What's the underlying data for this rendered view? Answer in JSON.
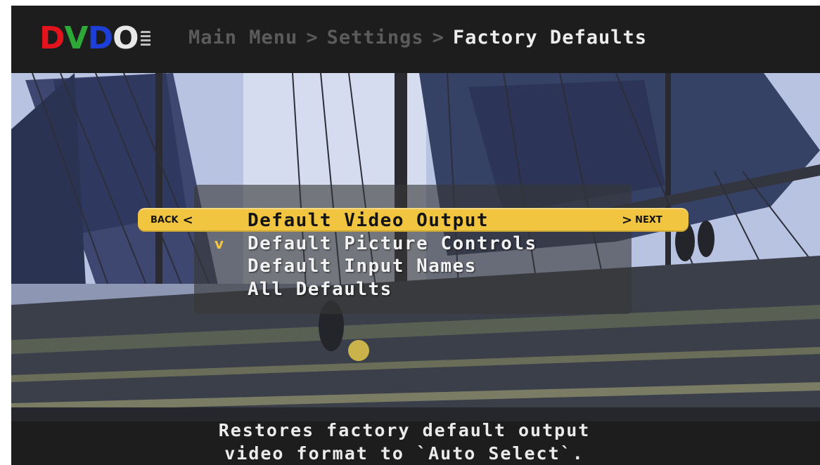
{
  "header": {
    "logo": {
      "letters": [
        "D",
        "V",
        "D",
        "O"
      ],
      "colors": [
        "#e4141c",
        "#2ea836",
        "#1e3fd6",
        "#e8e8e8"
      ]
    },
    "breadcrumb": {
      "items": [
        "Main Menu",
        "Settings",
        "Factory Defaults"
      ],
      "separator": ">"
    }
  },
  "menu": {
    "back_label": "BACK",
    "next_label": "NEXT",
    "back_arrow": "<",
    "next_arrow": ">",
    "items": [
      {
        "label": "Default Video Output",
        "selected": true,
        "checked": false
      },
      {
        "label": "Default Picture Controls",
        "selected": false,
        "checked": true
      },
      {
        "label": "Default Input Names",
        "selected": false,
        "checked": false
      },
      {
        "label": "All Defaults",
        "selected": false,
        "checked": false
      }
    ],
    "check_glyph": "v",
    "highlight_color": "#f1c540"
  },
  "footer": {
    "description_lines": [
      "Restores factory default output",
      "video format to `Auto Select`."
    ]
  },
  "background": {
    "icon": "tall-ship-photo"
  }
}
